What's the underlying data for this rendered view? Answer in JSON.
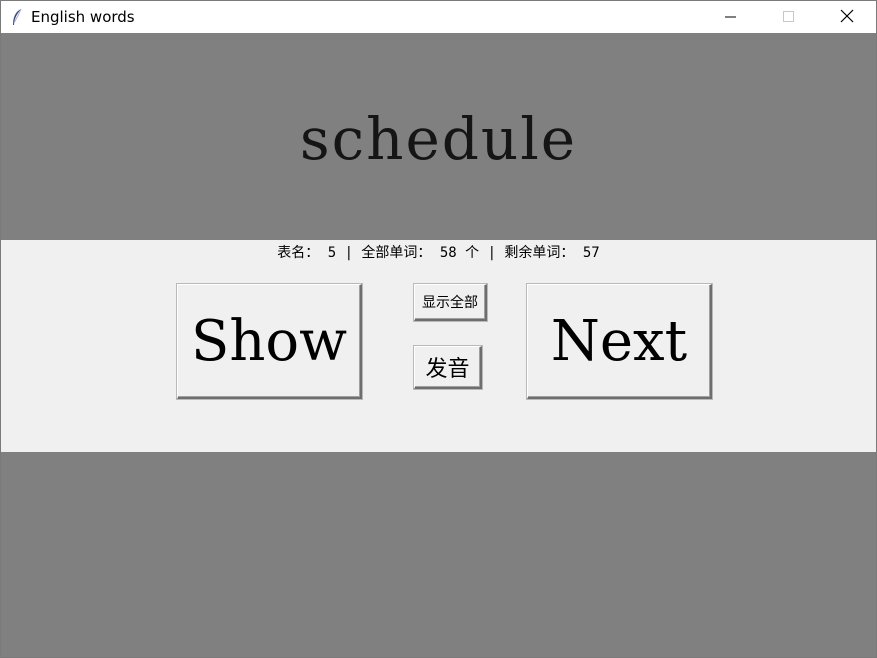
{
  "window": {
    "title": "English words",
    "icon": "feather-icon",
    "controls": [
      "minimize-icon",
      "maximize-icon",
      "close-icon"
    ]
  },
  "word": {
    "text": "schedule"
  },
  "status": {
    "text": "表名： 5 | 全部单词： 58 个 | 剩余单词： 57"
  },
  "buttons": {
    "show_label": "Show",
    "show_all_label": "显示全部",
    "pronounce_label": "发音",
    "next_label": "Next"
  },
  "colors": {
    "background_gray": "#808080",
    "panel": "#f0f0f0",
    "titlebar": "#ffffff"
  }
}
